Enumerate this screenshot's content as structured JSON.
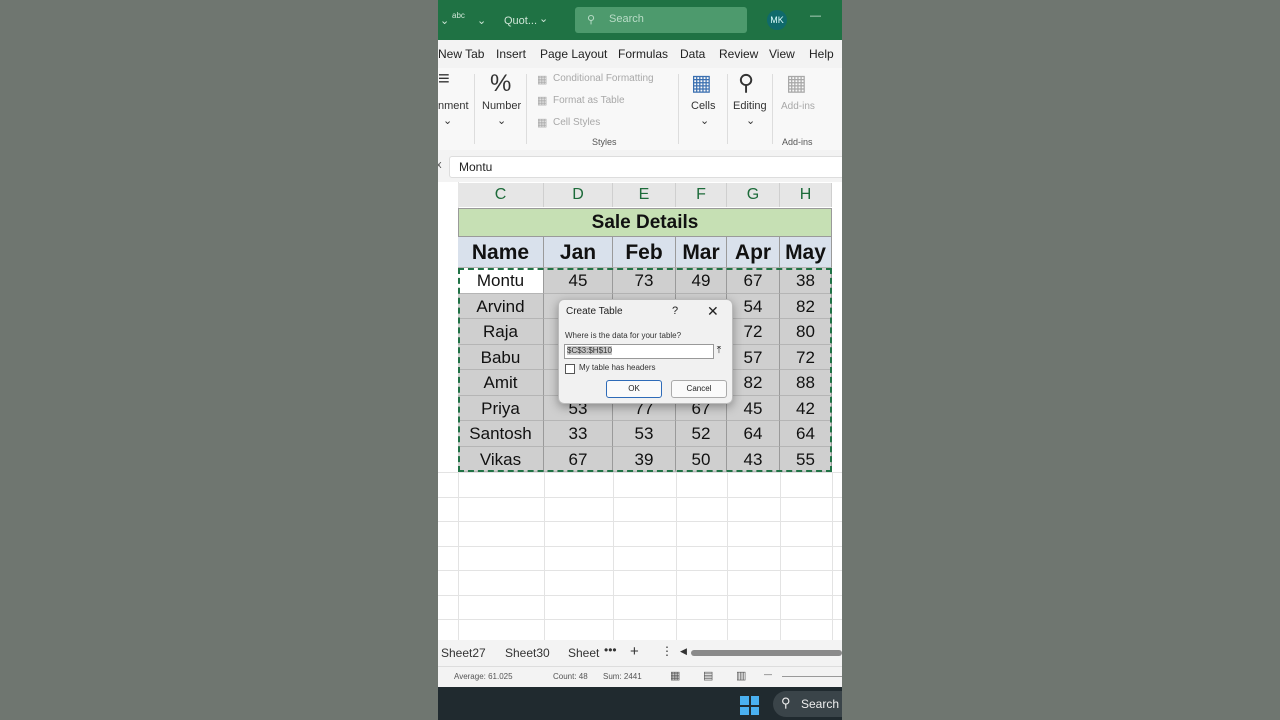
{
  "titlebar": {
    "quick1": "abc",
    "doc_title": "Quot...",
    "search_placeholder": "Search",
    "avatar": "MK"
  },
  "tabs": [
    "New Tab",
    "Insert",
    "Page Layout",
    "Formulas",
    "Data",
    "Review",
    "View",
    "Help"
  ],
  "ribbon": {
    "alignment": "nment",
    "number": "Number",
    "conditional_formatting": "Conditional Formatting",
    "format_as_table": "Format as Table",
    "cell_styles": "Cell Styles",
    "styles_caption": "Styles",
    "cells": "Cells",
    "editing": "Editing",
    "addins": "Add-ins",
    "addins_caption": "Add-ins"
  },
  "formula_bar": {
    "value": "Montu"
  },
  "columns": [
    "C",
    "D",
    "E",
    "F",
    "G",
    "H"
  ],
  "sheet": {
    "title": "Sale Details",
    "headers": [
      "Name",
      "Jan",
      "Feb",
      "Mar",
      "Apr",
      "May"
    ],
    "rows": [
      [
        "Montu",
        "45",
        "73",
        "49",
        "67",
        "38"
      ],
      [
        "Arvind",
        "",
        "",
        "",
        "54",
        "82"
      ],
      [
        "Raja",
        "",
        "",
        "",
        "72",
        "80"
      ],
      [
        "Babu",
        "",
        "",
        "",
        "57",
        "72"
      ],
      [
        "Amit",
        "",
        "",
        "",
        "82",
        "88"
      ],
      [
        "Priya",
        "53",
        "77",
        "67",
        "45",
        "42"
      ],
      [
        "Santosh",
        "33",
        "53",
        "52",
        "64",
        "64"
      ],
      [
        "Vikas",
        "67",
        "39",
        "50",
        "43",
        "55"
      ]
    ]
  },
  "dialog": {
    "title": "Create Table",
    "help": "?",
    "close": "✕",
    "prompt": "Where is the data for your table?",
    "range": "$C$3:$H$10",
    "headers_checkbox": "My table has headers",
    "ok": "OK",
    "cancel": "Cancel"
  },
  "sheet_tabs": [
    "Sheet27",
    "Sheet30",
    "Sheet"
  ],
  "status": {
    "average": "Average: 61.025",
    "count": "Count: 48",
    "sum": "Sum: 2441"
  },
  "taskbar": {
    "search": "Search"
  }
}
